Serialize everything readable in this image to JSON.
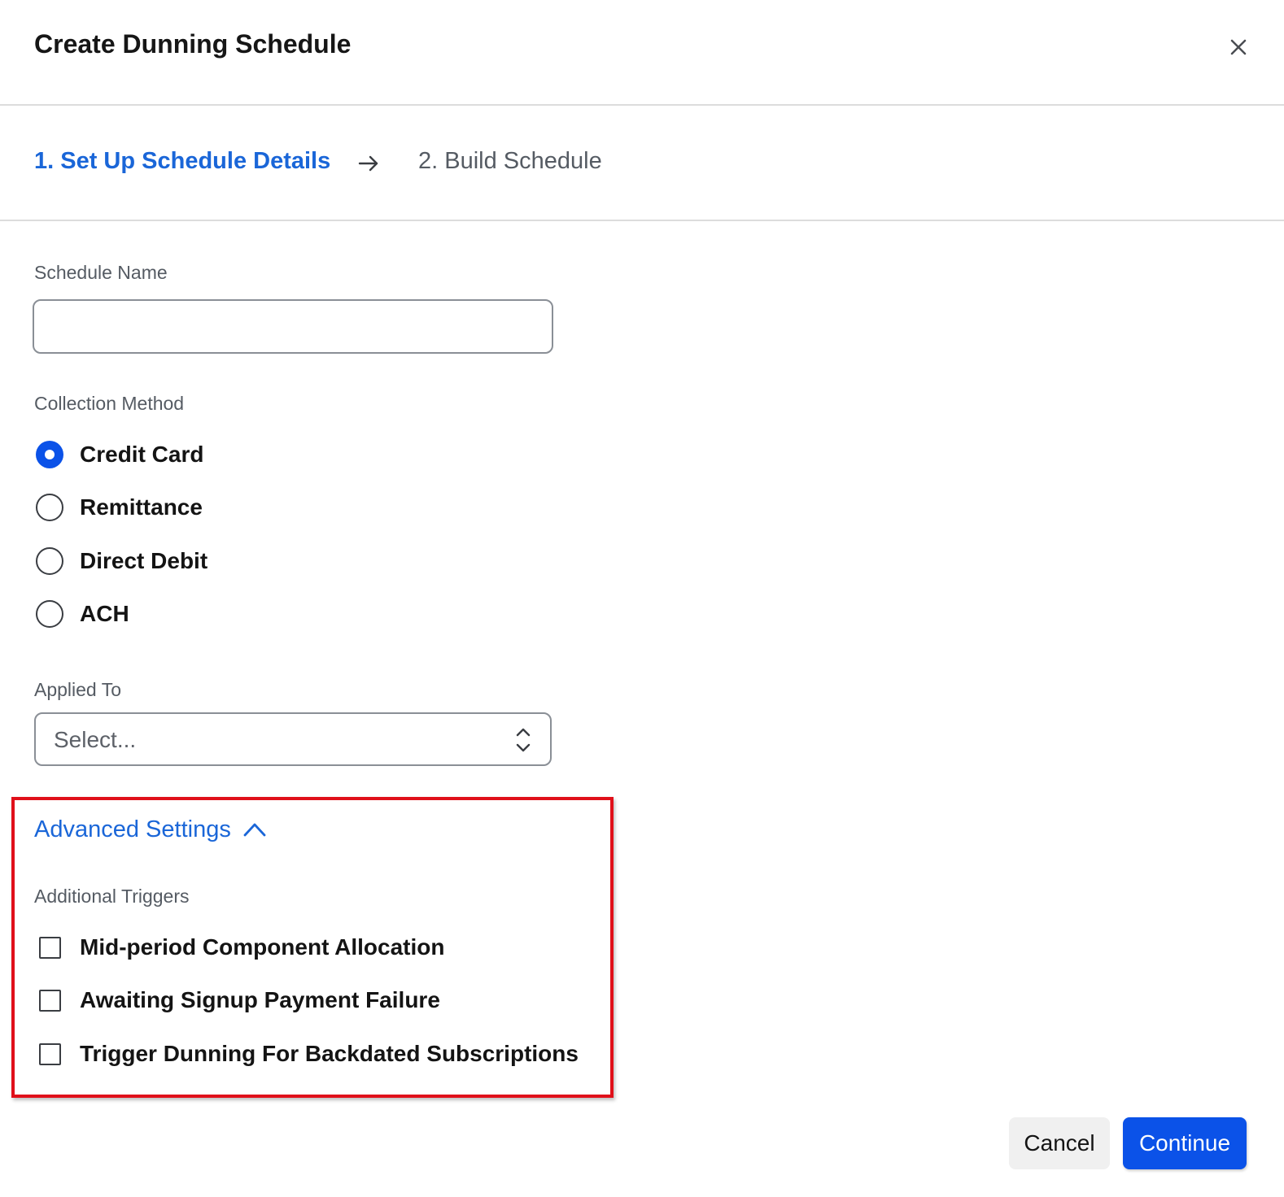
{
  "modal": {
    "title": "Create Dunning Schedule",
    "close_icon": "close-icon"
  },
  "steps": {
    "step1": "1. Set Up Schedule Details",
    "step2": "2. Build Schedule",
    "active_step": 1,
    "arrow_icon": "arrow-right-icon"
  },
  "schedule_name": {
    "label": "Schedule Name",
    "value": "",
    "placeholder": ""
  },
  "collection_method": {
    "label": "Collection Method",
    "options": [
      {
        "label": "Credit Card",
        "checked": true
      },
      {
        "label": "Remittance",
        "checked": false
      },
      {
        "label": "Direct Debit",
        "checked": false
      },
      {
        "label": "ACH",
        "checked": false
      }
    ]
  },
  "applied_to": {
    "label": "Applied To",
    "value": "Select...",
    "icon": "chevron-up-down-icon"
  },
  "advanced_settings": {
    "label": "Advanced Settings",
    "expanded": true,
    "icon": "chevron-up-icon",
    "triggers_label": "Additional Triggers",
    "triggers": [
      {
        "label": "Mid-period Component Allocation",
        "checked": false
      },
      {
        "label": "Awaiting Signup Payment Failure",
        "checked": false
      },
      {
        "label": "Trigger Dunning For Backdated Subscriptions",
        "checked": false
      }
    ]
  },
  "footer": {
    "cancel_label": "Cancel",
    "continue_label": "Continue"
  },
  "colors": {
    "accent": "#0b52e8",
    "link": "#1a66d8",
    "highlight": "#e0101a"
  }
}
